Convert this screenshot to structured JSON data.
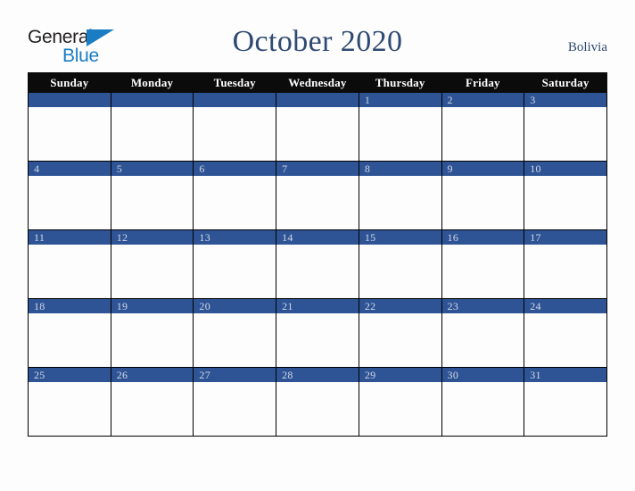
{
  "logo": {
    "word1": "General",
    "word2": "Blue",
    "triangle_color": "#1a7dc4",
    "word1_color": "#231f20",
    "word2_color": "#1a7dc4"
  },
  "header": {
    "title": "October 2020",
    "region": "Bolivia",
    "title_color": "#2f4a72"
  },
  "calendar": {
    "month": "October",
    "year": "2020",
    "weekday_headers": [
      "Sunday",
      "Monday",
      "Tuesday",
      "Wednesday",
      "Thursday",
      "Friday",
      "Saturday"
    ],
    "header_bg": "#0b0b0b",
    "header_fg": "#ffffff",
    "daynum_band_color": "#2e5496",
    "daynum_text_color": "#d2d8e4",
    "cell_bg": "#fdfdfd",
    "border_color": "#000000",
    "weeks": [
      [
        "",
        "",
        "",
        "",
        "1",
        "2",
        "3"
      ],
      [
        "4",
        "5",
        "6",
        "7",
        "8",
        "9",
        "10"
      ],
      [
        "11",
        "12",
        "13",
        "14",
        "15",
        "16",
        "17"
      ],
      [
        "18",
        "19",
        "20",
        "21",
        "22",
        "23",
        "24"
      ],
      [
        "25",
        "26",
        "27",
        "28",
        "29",
        "30",
        "31"
      ]
    ],
    "events": []
  },
  "page": {
    "background": "#fdfdfd"
  }
}
